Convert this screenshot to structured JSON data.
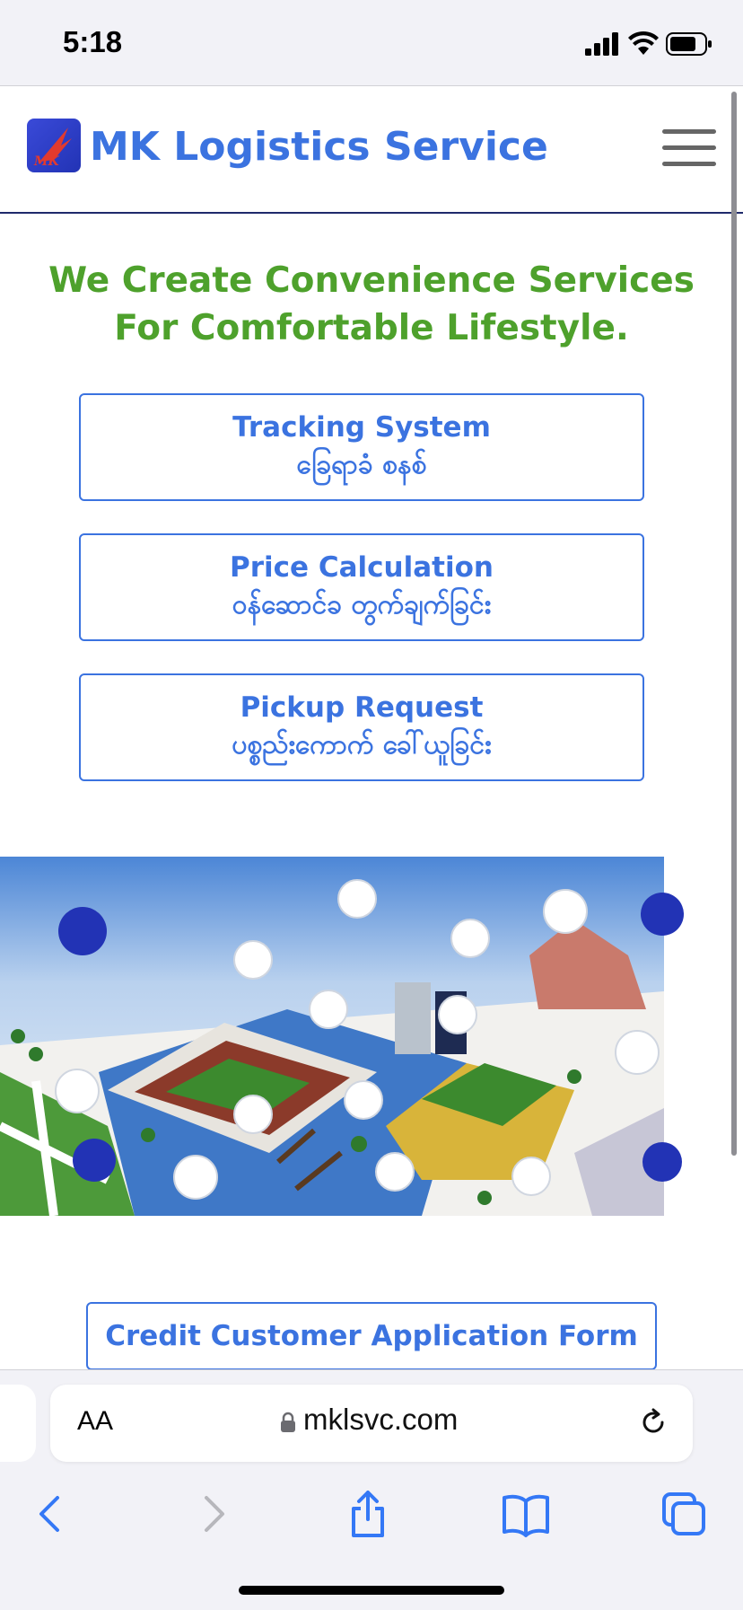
{
  "status_bar": {
    "time": "5:18"
  },
  "header": {
    "title": "MK Logistics Service",
    "logo_text": "MK"
  },
  "headline": "We Create Convenience Services For Comfortable Lifestyle.",
  "actions": [
    {
      "label_en": "Tracking System",
      "label_my": "ခြေရာခံ စနစ်"
    },
    {
      "label_en": "Price Calculation",
      "label_my": "ဝန်ဆောင်ခ တွက်ချက်ခြင်း"
    },
    {
      "label_en": "Pickup Request",
      "label_my": "ပစ္စည်းကောက် ခေါ်ယူခြင်း"
    }
  ],
  "credit_button": "Credit Customer Application Form",
  "browser": {
    "text_size_label": "AA",
    "url": "mklsvc.com"
  },
  "colors": {
    "brand_blue": "#3b73e0",
    "headline_green": "#4ea12c"
  }
}
